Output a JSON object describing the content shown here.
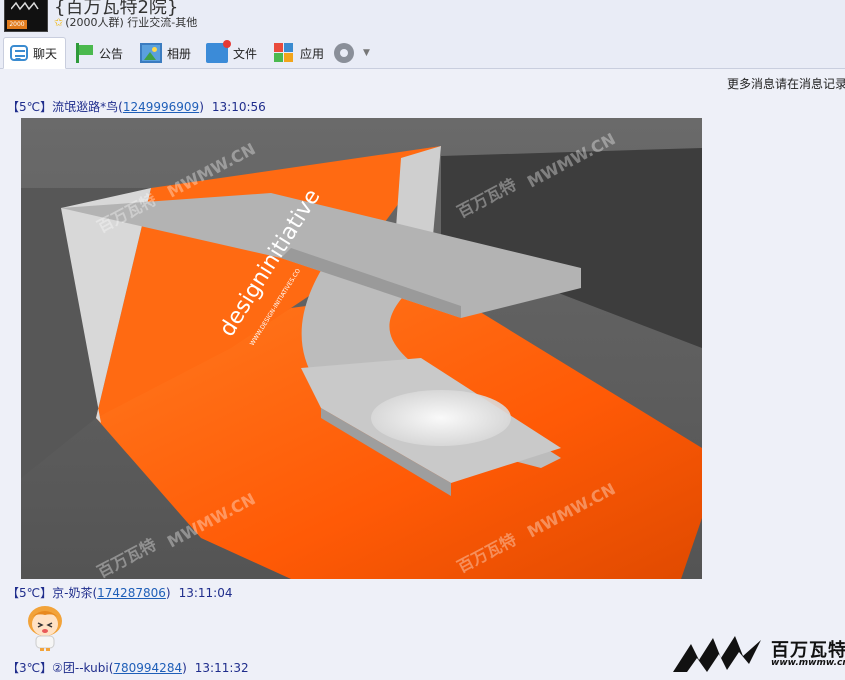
{
  "header": {
    "title": "{百万瓦特2院}",
    "member_count": "(2000人群)",
    "category": "行业交流-其他",
    "avatar_badge": "2000"
  },
  "toolbar": {
    "tabs": [
      {
        "label": "聊天",
        "icon": "chat-icon",
        "active": true
      },
      {
        "label": "公告",
        "icon": "announcement-flag-icon"
      },
      {
        "label": "相册",
        "icon": "photo-album-icon"
      },
      {
        "label": "文件",
        "icon": "folder-icon"
      },
      {
        "label": "应用",
        "icon": "apps-grid-icon"
      }
    ],
    "settings_icon": "gear-icon"
  },
  "more_history": "更多消息请在消息记录",
  "messages": [
    {
      "level": "【5℃】",
      "name": "流氓逖路*鸟",
      "qq": "1249996909",
      "time": "13:10:56"
    },
    {
      "level": "【5℃】",
      "name": "京-奶茶",
      "qq": "174287806",
      "time": "13:11:04"
    },
    {
      "level": "【3℃】",
      "name": "②团--kubi",
      "qq": "780994284",
      "time": "13:11:32"
    }
  ],
  "render_image": {
    "watermark": "MWMW.CN",
    "watermark_cn": "百万瓦特",
    "wall_text": "designinitiative",
    "wall_subtext": "WWW.DESIGN-INITIATIVES.CO"
  },
  "site_logo": {
    "brand": "百万瓦特",
    "url": "www.mwmw.cn"
  },
  "colors": {
    "accent_orange": "#ff5a0a",
    "link_blue": "#1f5fb8",
    "name_blue": "#1f2d8c",
    "background": "#eef0f8"
  }
}
